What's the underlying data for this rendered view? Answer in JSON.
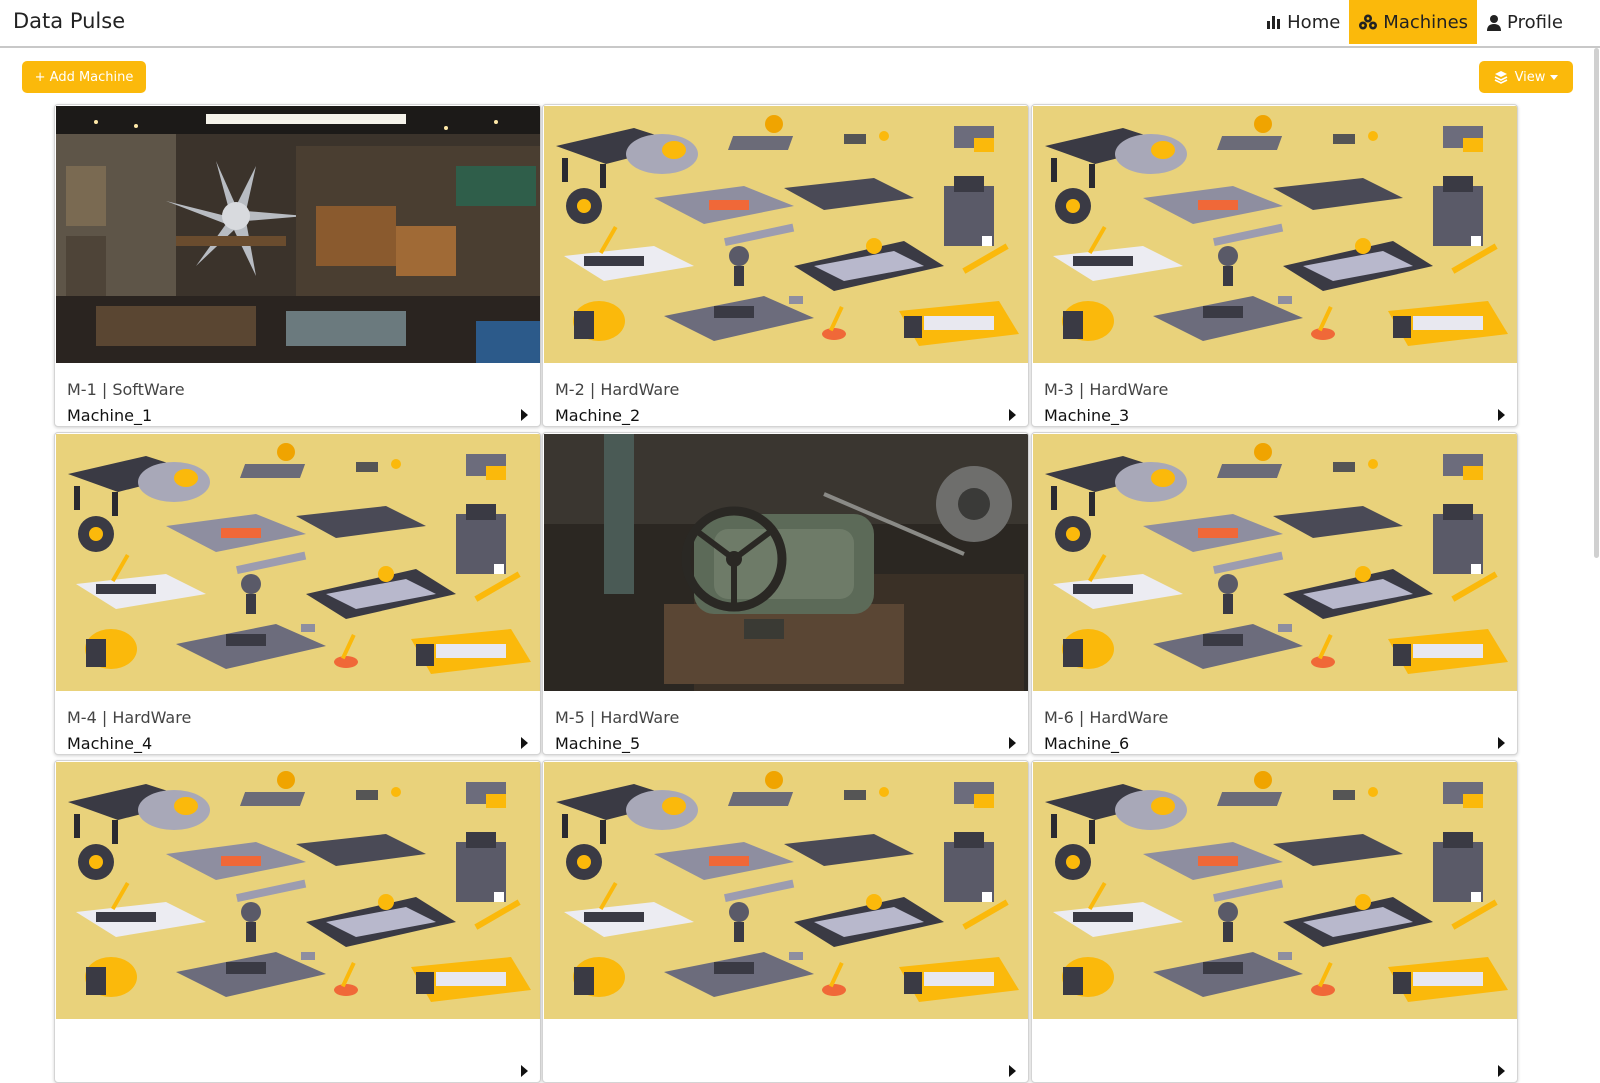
{
  "app": {
    "brand": "Data Pulse"
  },
  "nav": {
    "items": [
      {
        "label": "Home",
        "icon": "bar-chart-icon",
        "active": false
      },
      {
        "label": "Machines",
        "icon": "cogs-icon",
        "active": true
      },
      {
        "label": "Profile",
        "icon": "user-icon",
        "active": false
      }
    ]
  },
  "toolbar": {
    "add_label": "+ Add Machine",
    "view_label": "View"
  },
  "colors": {
    "accent": "#fbb90b",
    "illustration_bg": "#e9d27b"
  },
  "machines": [
    {
      "sub": "M-1 | SoftWare",
      "name": "Machine_1",
      "image": "workshop-photo"
    },
    {
      "sub": "M-2 | HardWare",
      "name": "Machine_2",
      "image": "machines-illustration"
    },
    {
      "sub": "M-3 | HardWare",
      "name": "Machine_3",
      "image": "machines-illustration"
    },
    {
      "sub": "M-4 | HardWare",
      "name": "Machine_4",
      "image": "machines-illustration"
    },
    {
      "sub": "M-5 | HardWare",
      "name": "Machine_5",
      "image": "lathe-photo"
    },
    {
      "sub": "M-6 | HardWare",
      "name": "Machine_6",
      "image": "machines-illustration"
    },
    {
      "sub": "",
      "name": "",
      "image": "machines-illustration"
    },
    {
      "sub": "",
      "name": "",
      "image": "machines-illustration"
    },
    {
      "sub": "",
      "name": "",
      "image": "machines-illustration"
    }
  ]
}
